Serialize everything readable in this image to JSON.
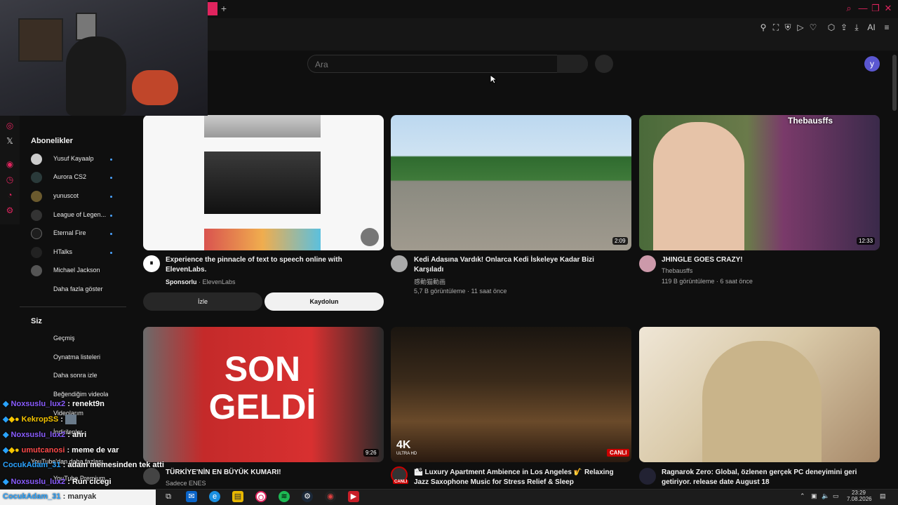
{
  "browser": {
    "new_tab": "+",
    "ai_label": "AI"
  },
  "search": {
    "placeholder": "Ara"
  },
  "user": {
    "avatar_letter": "y"
  },
  "sidebar": {
    "subscriptions_title": "Abonelikler",
    "subscriptions": [
      {
        "name": "Yusuf Kayaalp"
      },
      {
        "name": "Aurora CS2"
      },
      {
        "name": "yunuscot"
      },
      {
        "name": "League of Legen..."
      },
      {
        "name": "Eternal Fire"
      },
      {
        "name": "HTalks"
      },
      {
        "name": "Michael Jackson"
      }
    ],
    "show_more": "Daha fazla göster",
    "you_title": "Siz",
    "you_items": [
      "Geçmiş",
      "Oynatma listeleri",
      "Daha sonra izle",
      "Beğendiğim videolar",
      "Videolarım",
      "İndirilenler",
      "YouTube'dan daha fazlası",
      "YouTube Premium"
    ]
  },
  "ad": {
    "title_line1": "Experience the pinnacle of text to speech online with",
    "title_line2": "ElevenLabs.",
    "sponsored": "Sponsorlu",
    "advertiser": "· ElevenLabs",
    "watch": "İzle",
    "signup": "Kaydolun"
  },
  "videos": [
    {
      "title_line1": "Kedi Adasına Vardık! Onlarca Kedi İskeleye Kadar Bizi",
      "title_line2": "Karşıladı",
      "channel": "感動猫動画",
      "meta": "5,7 B görüntüleme · 11 saat önce",
      "duration": "2:09"
    },
    {
      "title_line1": "JHINGLE GOES CRAZY!",
      "channel": "Thebausffs",
      "meta": "119 B görüntüleme · 6 saat önce",
      "duration": "12:33",
      "thumb_overlay": "Thebausffs"
    },
    {
      "title_line1": "TÜRKİYE'NİN EN BÜYÜK KUMARI!",
      "channel": "Sadece ENES",
      "duration": "9:26",
      "thumb_text1": "SON",
      "thumb_text2": "GELDİ"
    },
    {
      "title_line1": "🏙 Luxury Apartment Ambience in Los Angeles 🎷 Relaxing",
      "title_line2": "Jazz Saxophone Music for Stress Relief & Sleep",
      "live": "CANLI",
      "quality": "4K",
      "quality_sub": "ULTRA HD"
    },
    {
      "title_line1": "Ragnarok Zero: Global, özlenen gerçek PC deneyimini geri",
      "title_line2": "getiriyor. release date August 18"
    }
  ],
  "chat": [
    {
      "user": "Noxsuslu_lux2",
      "msg": ": renekt9n"
    },
    {
      "user": "KekropSS",
      "msg": ":"
    },
    {
      "user": "Noxsuslu_lux2",
      "msg": ": ahri"
    },
    {
      "user": "umutcanosi",
      "msg": ": meme de var"
    },
    {
      "user": "CocukAdam_31",
      "msg": ": adam memesinden tek atti"
    },
    {
      "user": "Noxsuslu_lux2",
      "msg": ": Run cicegi"
    },
    {
      "user": "CocukAdam_31",
      "msg": ": manyak"
    }
  ],
  "taskbar": {
    "time": "23:29",
    "date": "7.08.2026"
  },
  "colors": {
    "accent": "#e0245e",
    "background": "#0f0f0f",
    "chat_user": "#8a5cff"
  }
}
